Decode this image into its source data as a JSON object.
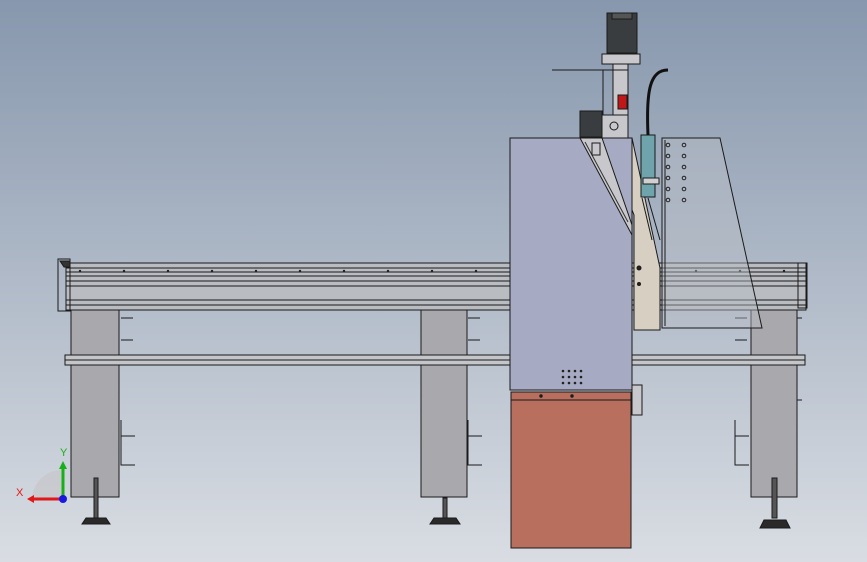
{
  "viewport": {
    "background_top": "#8797ad",
    "background_bottom": "#d9dde3"
  },
  "colors": {
    "frame_fill": "#b9bcc1",
    "frame_line": "#1a1a1a",
    "column_fill": "#a3a8b8",
    "gantry_panel": "#a6abc3",
    "base_box": "#b86f5d",
    "carriage_plate": "#d7cfc2",
    "shield_fill": "#b8bcc5",
    "spindle": "#6fa4ad",
    "magenta_part": "#c040c0",
    "red_part": "#c01818",
    "leg_fill": "#a9a9ad",
    "motor_fill": "#3a3d3f"
  },
  "triad": {
    "x_label": "X",
    "y_label": "Y",
    "x_color": "#e01818",
    "y_color": "#18b018",
    "z_color": "#1818e0"
  }
}
